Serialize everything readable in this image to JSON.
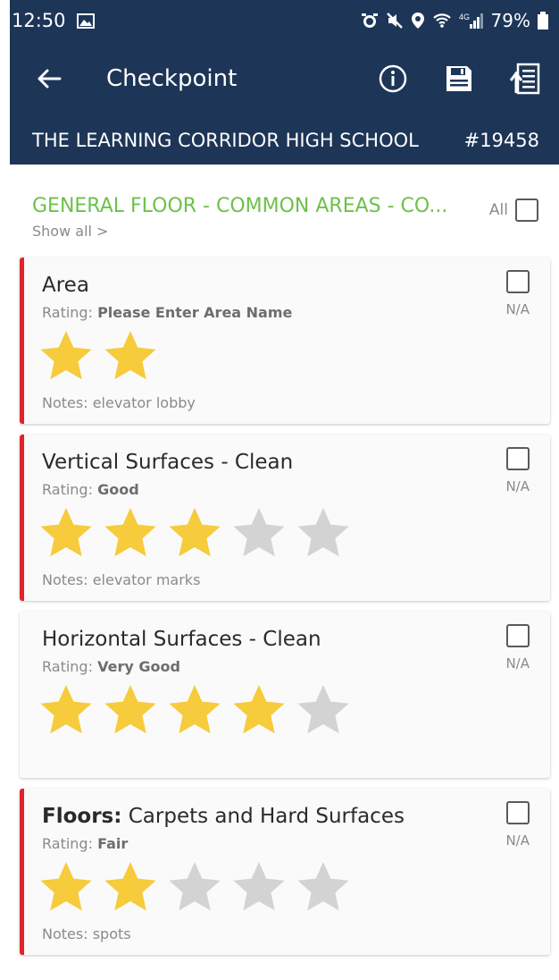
{
  "status_bar": {
    "time": "12:50",
    "battery": "79%"
  },
  "app_bar": {
    "title": "Checkpoint"
  },
  "school": {
    "name": "THE LEARNING CORRIDOR HIGH SCHOOL",
    "number": "#19458"
  },
  "section": {
    "title": "GENERAL FLOOR - COMMON AREAS - CO...",
    "show_all": "Show all >",
    "all_label": "All"
  },
  "rating_label": "Rating:",
  "notes_label": "Notes:",
  "na_label": "N/A",
  "colors": {
    "header": "#1d3557",
    "accent_green": "#6cc14a",
    "flag_red": "#e0242b",
    "star_on": "#f6cb3c",
    "star_off": "#d3d3d3"
  },
  "items": [
    {
      "title": "Area",
      "title_bold": "",
      "rating": "Please Enter Area Name",
      "stars": 2,
      "max_stars": 2,
      "notes": "elevator lobby",
      "flagged": true
    },
    {
      "title": "Vertical Surfaces - Clean",
      "title_bold": "",
      "rating": "Good",
      "stars": 3,
      "max_stars": 5,
      "notes": "elevator marks",
      "flagged": true
    },
    {
      "title": "Horizontal Surfaces - Clean",
      "title_bold": "",
      "rating": "Very Good",
      "stars": 4,
      "max_stars": 5,
      "notes": "",
      "flagged": false
    },
    {
      "title": "Carpets and Hard Surfaces",
      "title_bold": "Floors:",
      "rating": "Fair",
      "stars": 2,
      "max_stars": 5,
      "notes": "spots",
      "flagged": true
    }
  ]
}
